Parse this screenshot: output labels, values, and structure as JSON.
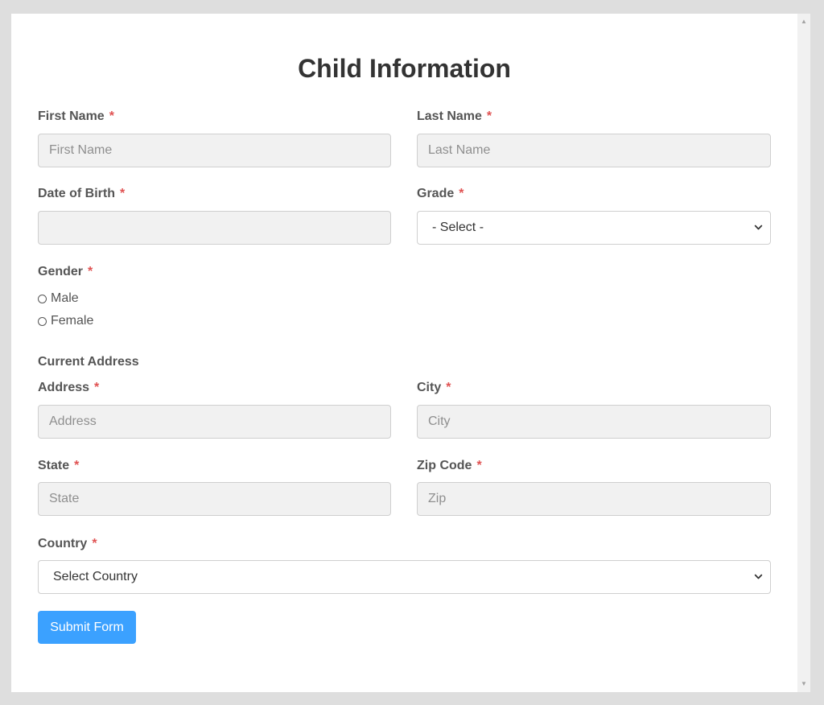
{
  "form": {
    "title": "Child Information",
    "required_marker": "*",
    "fields": {
      "first_name": {
        "label": "First Name",
        "placeholder": "First Name",
        "value": ""
      },
      "last_name": {
        "label": "Last Name",
        "placeholder": "Last Name",
        "value": ""
      },
      "dob": {
        "label": "Date of Birth",
        "placeholder": "",
        "value": ""
      },
      "grade": {
        "label": "Grade",
        "selected": "- Select -"
      },
      "gender": {
        "label": "Gender",
        "options": [
          "Male",
          "Female"
        ]
      },
      "address": {
        "label": "Address",
        "placeholder": "Address",
        "value": ""
      },
      "city": {
        "label": "City",
        "placeholder": "City",
        "value": ""
      },
      "state": {
        "label": "State",
        "placeholder": "State",
        "value": ""
      },
      "zip": {
        "label": "Zip Code",
        "placeholder": "Zip",
        "value": ""
      },
      "country": {
        "label": "Country",
        "selected": "Select Country"
      }
    },
    "address_section_label": "Current Address",
    "submit_label": "Submit Form"
  },
  "icons": {
    "select_arrow": "chevron-down-icon",
    "scroll_up": "scroll-up-arrow-icon",
    "scroll_down": "scroll-down-arrow-icon"
  },
  "colors": {
    "accent": "#3ba1ff",
    "required": "#e05252",
    "input_bg": "#f1f1f1",
    "page_bg": "#dedede"
  }
}
